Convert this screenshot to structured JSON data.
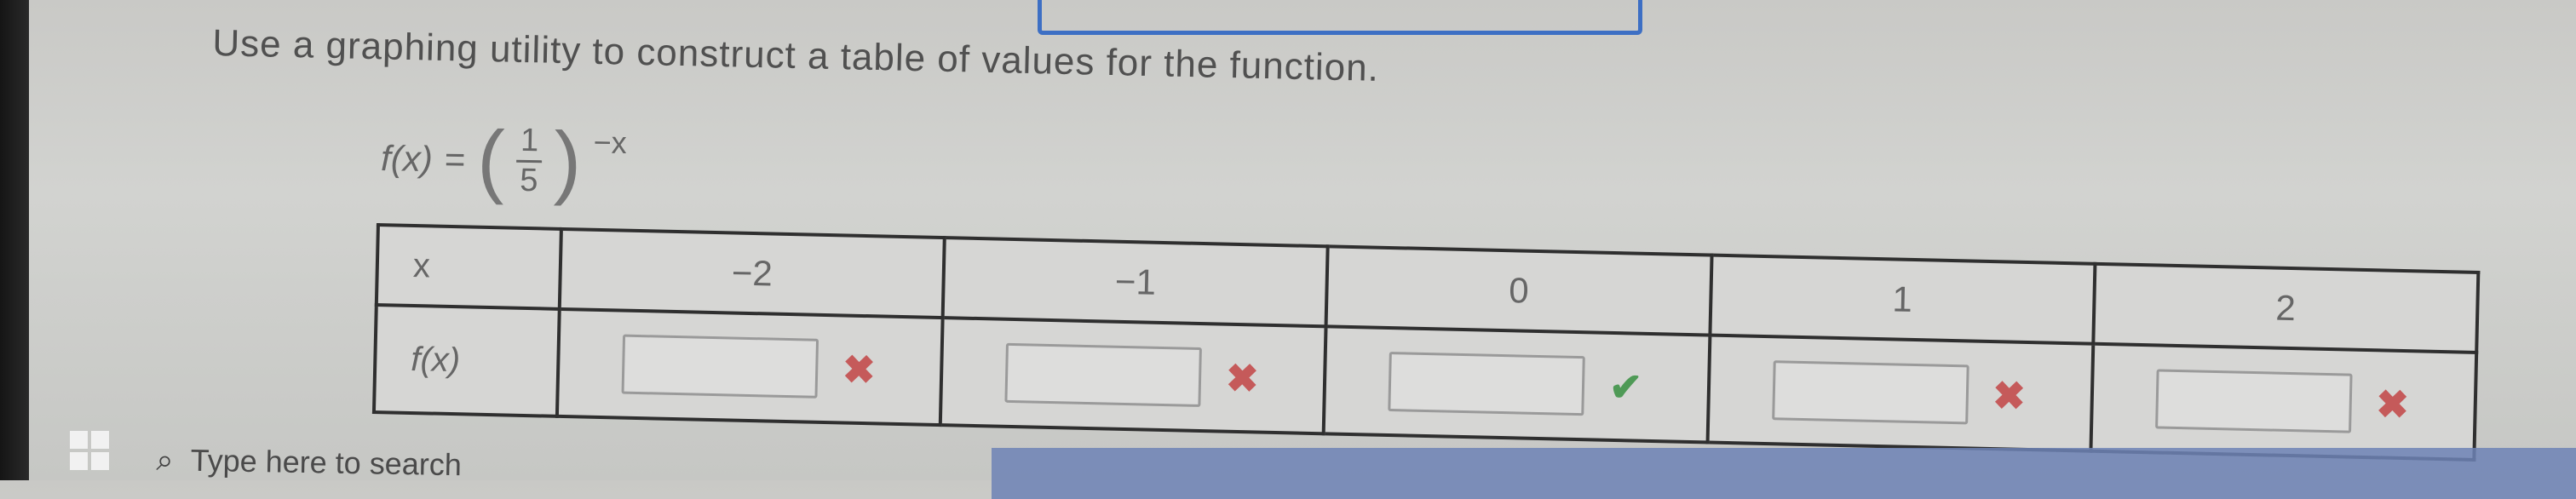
{
  "question": {
    "instruction": "Use a graphing utility to construct a table of values for the function."
  },
  "formula": {
    "lhs": "f(x)",
    "equals": "=",
    "numerator": "1",
    "denominator": "5",
    "exponent": "−x"
  },
  "table": {
    "row_labels": {
      "x": "x",
      "fx": "f(x)"
    },
    "x_values": [
      "−2",
      "−1",
      "0",
      "1",
      "2"
    ],
    "answers": [
      {
        "value": "",
        "status": "incorrect",
        "mark": "✖"
      },
      {
        "value": "",
        "status": "incorrect",
        "mark": "✖"
      },
      {
        "value": "",
        "status": "correct",
        "mark": "✔"
      },
      {
        "value": "",
        "status": "incorrect",
        "mark": "✖"
      },
      {
        "value": "",
        "status": "incorrect",
        "mark": "✖"
      }
    ]
  },
  "taskbar": {
    "search_placeholder": "Type here to search",
    "start_icon": "windows-logo-icon",
    "search_icon": "search-icon"
  },
  "colors": {
    "incorrect": "#c55a5a",
    "correct": "#4f9a56",
    "accent_border": "#3d6fc4"
  }
}
